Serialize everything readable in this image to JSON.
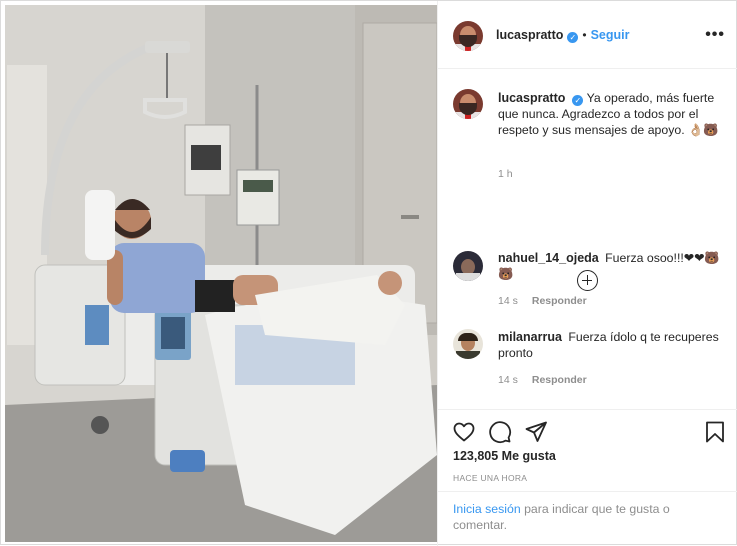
{
  "header": {
    "username": "lucaspratto",
    "separator": "•",
    "follow_label": "Seguir",
    "more_label": "•••"
  },
  "caption": {
    "username": "lucaspratto",
    "text": "Ya operado, más fuerte que nunca. Agradezco a todos por el respeto y sus mensajes de apoyo. 👌🏼🐻",
    "time": "1 h"
  },
  "comments": [
    {
      "username": "nahuel_14_ojeda",
      "text": "Fuerza osoo!!!❤❤🐻🐻",
      "time": "14 s",
      "reply_label": "Responder"
    },
    {
      "username": "milanarrua",
      "text": "Fuerza ídolo q te recuperes pronto",
      "time": "14 s",
      "reply_label": "Responder"
    }
  ],
  "actions": {
    "icons": [
      "heart-icon",
      "comment-icon",
      "share-icon",
      "bookmark-icon"
    ],
    "likes": "123,805 Me gusta",
    "posted": "HACE UNA HORA"
  },
  "login": {
    "link": "Inicia sesión",
    "text": " para indicar que te gusta o comentar."
  },
  "colors": {
    "accent": "#3897f0",
    "text": "#262626",
    "muted": "#8e8e8e",
    "border": "#efefef"
  }
}
